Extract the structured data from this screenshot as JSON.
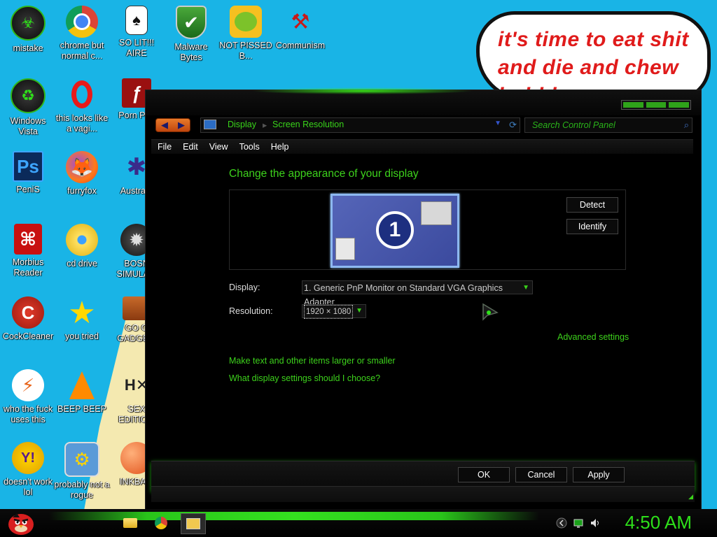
{
  "desktop": {
    "icons": [
      {
        "label": "mistake"
      },
      {
        "label": "chrome but normal c..."
      },
      {
        "label": "SO LIT!!! AIRE"
      },
      {
        "label": "Malware Bytes"
      },
      {
        "label": "NOT PISSED B..."
      },
      {
        "label": "Communism"
      },
      {
        "label": "Windows Vista"
      },
      {
        "label": "this looks like a vagi..."
      },
      {
        "label": "Porn Pl..."
      },
      {
        "label": "PeniS"
      },
      {
        "label": "furryfox"
      },
      {
        "label": "Austra..."
      },
      {
        "label": "Morbius Reader"
      },
      {
        "label": "cd drive"
      },
      {
        "label": "BOSN SIMULA..."
      },
      {
        "label": "CockCleaner"
      },
      {
        "label": "you tried"
      },
      {
        "label": "GO G GADGE..."
      },
      {
        "label": "who the fuck uses this"
      },
      {
        "label": "BEEP BEEP"
      },
      {
        "label": "SEX EDITIO..."
      },
      {
        "label": "doesn't work lol"
      },
      {
        "label": "probably not a rogue"
      },
      {
        "label": "INKBA..."
      }
    ],
    "wallpaper_text": [
      "it's time to eat shit",
      "and die and chew",
      "bubble gum"
    ]
  },
  "window": {
    "nav": {
      "back_label": "◀",
      "forward_label": "▶",
      "breadcrumb": [
        "Display",
        "Screen Resolution"
      ],
      "separator": "▸",
      "search_placeholder": "Search Control Panel"
    },
    "menu": [
      "File",
      "Edit",
      "View",
      "Tools",
      "Help"
    ],
    "title": "Change the appearance of your display",
    "monitor_number": "1",
    "detect_label": "Detect",
    "identify_label": "Identify",
    "display_label": "Display:",
    "display_value": "1. Generic PnP Monitor on Standard VGA Graphics Adapter",
    "resolution_label": "Resolution:",
    "resolution_value": "1920 × 1080",
    "advanced_link": "Advanced settings",
    "larger_link": "Make text and other items larger or smaller",
    "which_link": "What display settings should I choose?",
    "ok_label": "OK",
    "cancel_label": "Cancel",
    "apply_label": "Apply"
  },
  "taskbar": {
    "clock": "4:50 AM"
  },
  "colors": {
    "accent_green": "#3dd21c",
    "desktop_blue": "#19b4e6",
    "window_bg": "#000000"
  }
}
